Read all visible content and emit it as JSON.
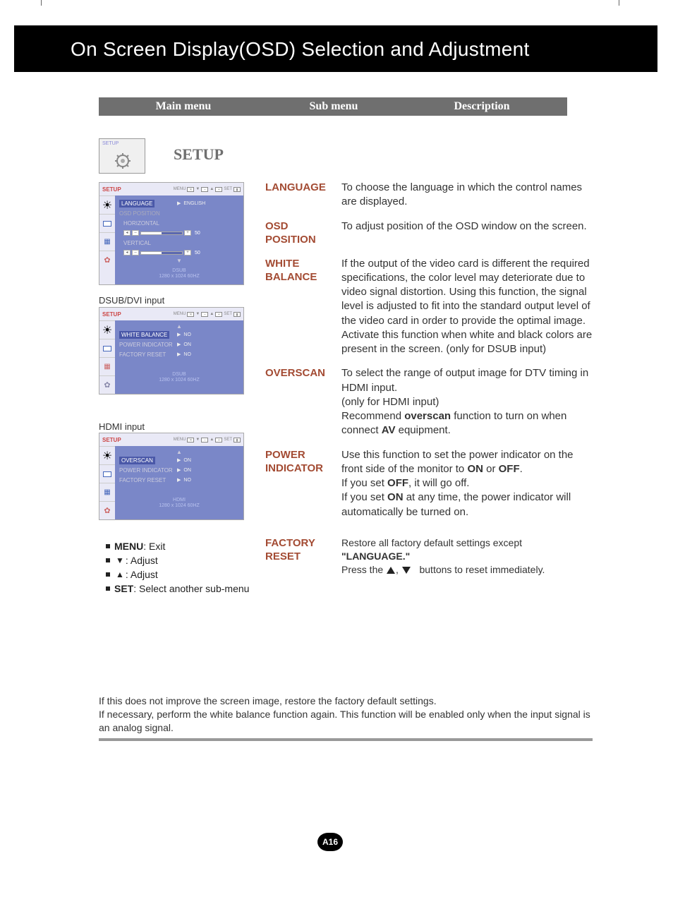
{
  "banner_title": "On Screen Display(OSD) Selection and Adjustment",
  "headers": {
    "main": "Main menu",
    "sub": "Sub menu",
    "desc": "Description"
  },
  "setup": {
    "icon_label": "SETUP",
    "title": "SETUP"
  },
  "osd1": {
    "title": "SETUP",
    "menu_btn": "MENU",
    "set_btn": "SET",
    "lang_label": "LANGUAGE",
    "lang_val": "ENGLISH",
    "osd_pos_label": "OSD  POSITION",
    "horiz_label": "HORIZONTAL",
    "horiz_val": "50",
    "vert_label": "VERTICAL",
    "vert_val": "50",
    "footer_line1": "DSUB",
    "footer_line2": "1280 x 1024  60HZ"
  },
  "input_label_1": "DSUB/DVI input",
  "osd2": {
    "title": "SETUP",
    "wb_label": "WHITE  BALANCE",
    "wb_val": "NO",
    "pi_label": "POWER  INDICATOR",
    "pi_val": "ON",
    "fr_label": "FACTORY  RESET",
    "fr_val": "NO",
    "footer_line1": "DSUB",
    "footer_line2": "1280 x 1024  60HZ"
  },
  "input_label_2": "HDMI input",
  "osd3": {
    "title": "SETUP",
    "ov_label": "OVERSCAN",
    "ov_val": "ON",
    "pi_label": "POWER  INDICATOR",
    "pi_val": "ON",
    "fr_label": "FACTORY  RESET",
    "fr_val": "NO",
    "footer_line1": "HDMI",
    "footer_line2": "1280 x 1024  60HZ"
  },
  "legend": {
    "menu": "MENU",
    "menu_desc": " : Exit",
    "down_desc": " : Adjust",
    "up_desc": " : Adjust",
    "set": "SET",
    "set_desc": " : Select another sub-menu"
  },
  "rows": [
    {
      "label": "LANGUAGE",
      "text": "To choose the language in which the control names are displayed."
    },
    {
      "label": "OSD POSITION",
      "text": "To adjust position of the OSD window on the screen."
    },
    {
      "label": "WHITE BALANCE",
      "text": "If the output of the video card is different the required specifications, the color level may deteriorate due to video signal distortion. Using this function, the signal level is adjusted to fit into the standard output level of the video card in order to provide the optimal image. Activate this function when white and black colors are present in the screen. (only for DSUB input)"
    },
    {
      "label": "OVERSCAN",
      "text_pre": "To select the range of output image for DTV timing in HDMI input.\n(only for HDMI input)\nRecommend ",
      "bold1": "overscan",
      "text_mid": " function to turn on when connect ",
      "bold2": "AV",
      "text_post": " equipment."
    },
    {
      "label": "POWER INDICATOR",
      "pi_1": "Use this function to set the power indicator on the front side of the monitor to ",
      "pi_on": "ON",
      "pi_or": " or ",
      "pi_off": "OFF",
      "pi_dot": ".",
      "pi_2a": "If you set ",
      "pi_2b": "OFF",
      "pi_2c": ", it will go off.",
      "pi_3a": "If you set ",
      "pi_3b": "ON",
      "pi_3c": " at any time, the power indicator will automatically be turned on."
    },
    {
      "label": "FACTORY RESET",
      "fr_1": "Restore all factory default settings except ",
      "fr_lang": "\"LANGUAGE.\"",
      "fr_2a": "Press the ",
      "fr_2b": " buttons to reset immediately."
    }
  ],
  "footnote": "If this does not improve the screen image, restore the factory default settings.\nIf necessary, perform the white balance function again. This function will be enabled only when the input signal is an analog signal.",
  "page": "A16"
}
